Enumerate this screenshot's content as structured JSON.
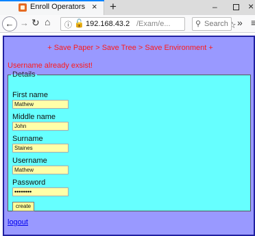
{
  "browser": {
    "tab_title": "Enroll Operators",
    "tab_close": "×",
    "new_tab": "+",
    "url_host": "192.168.43.2",
    "url_path": "/Exam/e...",
    "page_actions": "•••",
    "search_placeholder": "Search",
    "overflow": "»",
    "menu": "≡",
    "window_min": "–",
    "window_close": "×",
    "accent_color": "#0a84ff"
  },
  "page": {
    "breadcrumb": "+ Save Paper > Save Tree > Save Environment +",
    "error": "Username already exsist!",
    "legend": "Details",
    "fields": [
      {
        "label": "First name",
        "value": "Mathew"
      },
      {
        "label": "Middle name",
        "value": "John"
      },
      {
        "label": "Surname",
        "value": "Staines"
      },
      {
        "label": "Username",
        "value": "Mathew"
      },
      {
        "label": "Password",
        "value": "••••••••"
      }
    ],
    "create_label": "create",
    "logout_label": "logout",
    "colors": {
      "page_bg": "#9999ff",
      "border": "#1f1fa0",
      "fieldset_bg": "#66ffff",
      "input_bg": "#ffffa8",
      "error_text": "#ff1a1a",
      "link": "#0000ee"
    }
  }
}
